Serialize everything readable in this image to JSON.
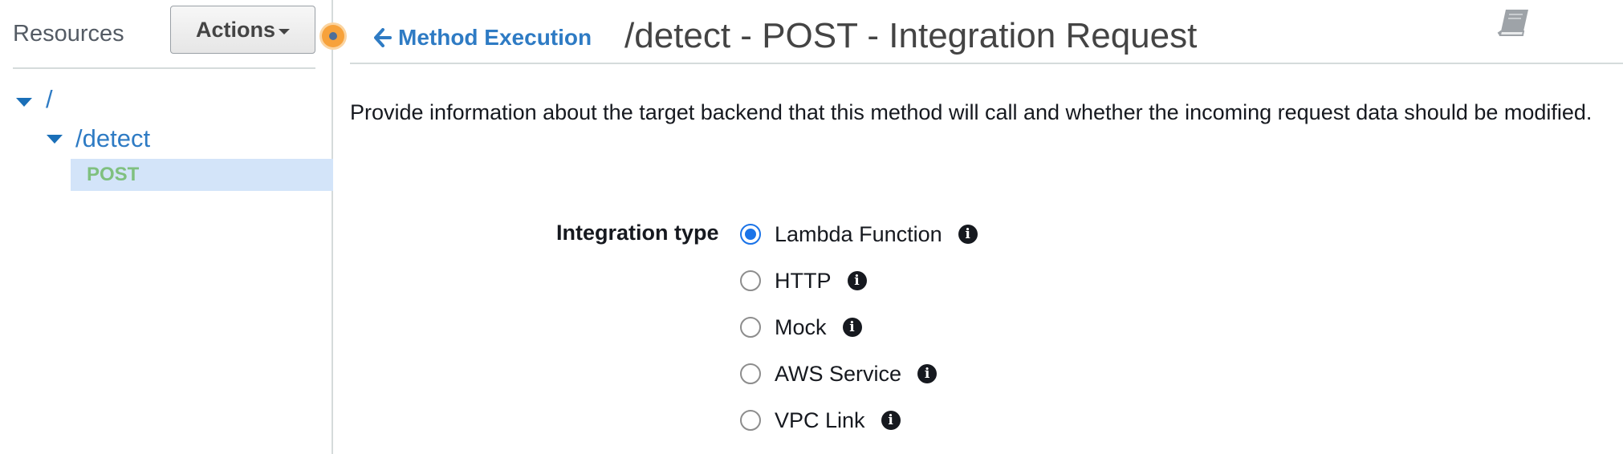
{
  "sidebar": {
    "title": "Resources",
    "actions_label": "Actions",
    "tree": {
      "root": {
        "label": "/"
      },
      "detect": {
        "label": "/detect"
      },
      "method": {
        "label": "POST"
      }
    }
  },
  "header": {
    "back_link": "Method Execution",
    "title": "/detect - POST - Integration Request",
    "icons": {
      "back": "arrow-left-icon",
      "help": "book-icon"
    }
  },
  "main": {
    "description": "Provide information about the target backend that this method will call and whether the incoming request data should be modified.",
    "integration_type": {
      "label": "Integration type",
      "selected": "Lambda Function",
      "options": [
        {
          "label": "Lambda Function",
          "checked": true
        },
        {
          "label": "HTTP",
          "checked": false
        },
        {
          "label": "Mock",
          "checked": false
        },
        {
          "label": "AWS Service",
          "checked": false
        },
        {
          "label": "VPC Link",
          "checked": false
        }
      ]
    }
  },
  "colors": {
    "link": "#2e7bc4",
    "method_label": "#7fc07f",
    "selected_row": "#d3e4f9",
    "radio_checked": "#1a73e8",
    "resize_handle": "#f7a23b"
  }
}
